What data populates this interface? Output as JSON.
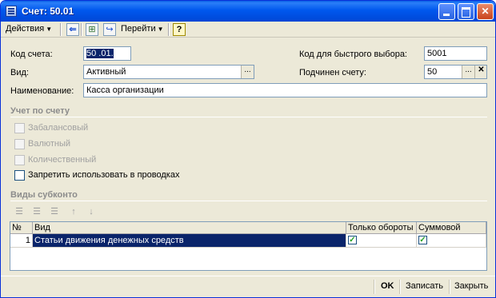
{
  "window": {
    "title": "Счет: 50.01"
  },
  "toolbar": {
    "actions_label": "Действия",
    "goto_label": "Перейти",
    "help_label": "?"
  },
  "form": {
    "code_label": "Код счета:",
    "code_value": "50 .01.",
    "kind_label": "Вид:",
    "kind_value": "Активный",
    "name_label": "Наименование:",
    "name_value": "Касса организации",
    "quick_code_label": "Код для быстрого выбора:",
    "quick_code_value": "5001",
    "parent_label": "Подчинен счету:",
    "parent_value": "50"
  },
  "accounting": {
    "section_title": "Учет по счету",
    "checkboxes": [
      {
        "label": "Забалансовый",
        "checked": false,
        "enabled": false
      },
      {
        "label": "Валютный",
        "checked": false,
        "enabled": false
      },
      {
        "label": "Количественный",
        "checked": false,
        "enabled": false
      },
      {
        "label": "Запретить использовать в проводках",
        "checked": false,
        "enabled": true
      }
    ]
  },
  "subconto": {
    "section_title": "Виды субконто",
    "columns": [
      "№",
      "Вид",
      "Только обороты",
      "Суммовой"
    ],
    "rows": [
      {
        "num": "1",
        "kind": "Статьи движения денежных средств",
        "turnover_only": true,
        "sum": true
      }
    ]
  },
  "bottom": {
    "ok_label": "OK",
    "save_label": "Записать",
    "close_label": "Закрыть"
  },
  "icons": {
    "window": "account-form-icon",
    "back": "arrow-left-icon",
    "structure": "structure-icon",
    "goto": "goto-icon",
    "help": "help-icon"
  }
}
